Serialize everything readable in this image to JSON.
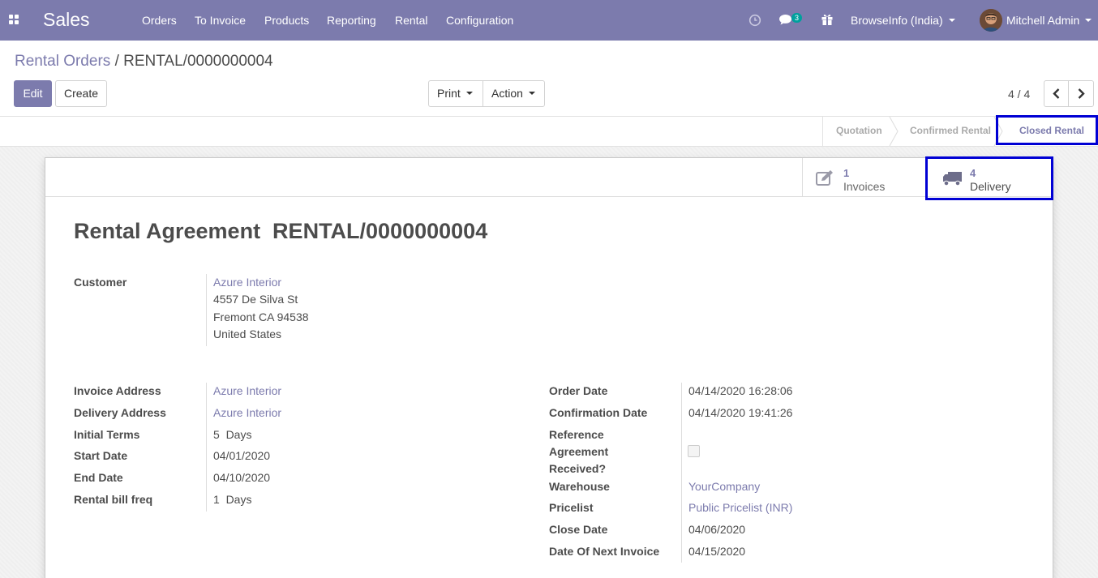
{
  "navbar": {
    "app_name": "Sales",
    "menu": [
      "Orders",
      "To Invoice",
      "Products",
      "Reporting",
      "Rental",
      "Configuration"
    ],
    "message_count": "3",
    "company": "BrowseInfo (India)",
    "user": "Mitchell Admin",
    "icons": [
      "apps-grid-icon",
      "clock-icon",
      "chat-icon",
      "gift-icon",
      "avatar"
    ],
    "bg_color": "#7c7bad"
  },
  "breadcrumb": {
    "parent": "Rental Orders",
    "separator": "/",
    "current": "RENTAL/0000000004"
  },
  "toolbar": {
    "edit": "Edit",
    "create": "Create",
    "print": "Print",
    "action": "Action"
  },
  "pager": {
    "value": "4 / 4"
  },
  "status": {
    "stages": [
      "Quotation",
      "Confirmed Rental",
      "Closed Rental"
    ],
    "active": "Closed Rental"
  },
  "smart_buttons": {
    "invoices": {
      "count": "1",
      "label": "Invoices"
    },
    "delivery": {
      "count": "4",
      "label": "Delivery"
    }
  },
  "form": {
    "title": "Rental Agreement  RENTAL/0000000004",
    "customer_label": "Customer",
    "customer_name": "Azure Interior",
    "customer_address": [
      "4557 De Silva St",
      "Fremont CA 94538",
      "United States"
    ],
    "left_fields": [
      {
        "label": "Invoice Address",
        "value": "Azure Interior"
      },
      {
        "label": "Delivery Address",
        "value": "Azure Interior"
      },
      {
        "label": "Initial Terms",
        "value": "5  Days"
      },
      {
        "label": "Start Date",
        "value": "04/01/2020"
      },
      {
        "label": "End Date",
        "value": "04/10/2020"
      },
      {
        "label": "Rental bill freq",
        "value": "1  Days"
      }
    ],
    "right_fields": [
      {
        "label": "Order Date",
        "value": "04/14/2020 16:28:06"
      },
      {
        "label": "Confirmation Date",
        "value": "04/14/2020 19:41:26"
      },
      {
        "label_lines": [
          "Reference",
          "Agreement",
          "Received?"
        ],
        "value": ""
      },
      {
        "label": "Warehouse",
        "value": "YourCompany"
      },
      {
        "label": "Pricelist",
        "value": "Public Pricelist (INR)"
      },
      {
        "label": "Close Date",
        "value": "04/06/2020"
      },
      {
        "label": "Date Of Next Invoice",
        "value": "04/15/2020"
      }
    ]
  }
}
